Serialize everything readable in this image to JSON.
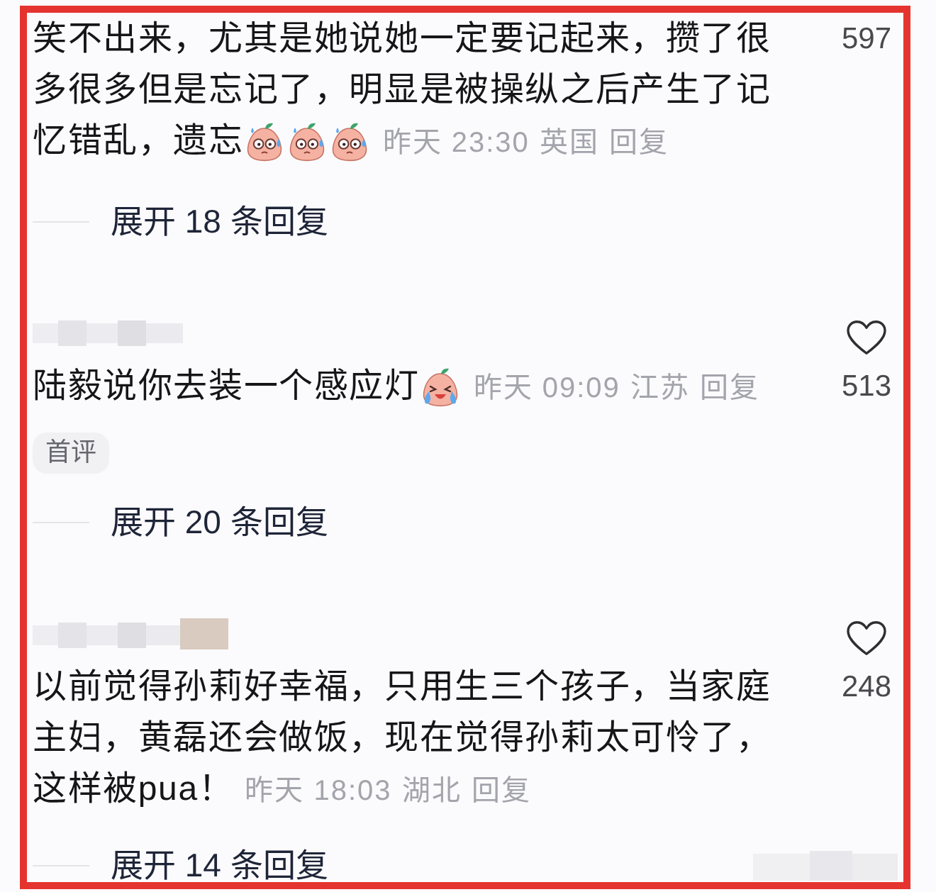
{
  "comments": [
    {
      "author_shown": false,
      "text": "笑不出来，尤其是她说她一定要记起来，攒了很多很多但是忘记了，明显是被操纵之后产生了记忆错乱，遗忘",
      "emojis": [
        {
          "kind": "nervous"
        },
        {
          "kind": "nervous"
        },
        {
          "kind": "nervous"
        }
      ],
      "time": "昨天 23:30",
      "location": "英国",
      "reply": "回复",
      "likes": "597",
      "expand": "展开 18 条回复"
    },
    {
      "author_shown": true,
      "liked": false,
      "text": "陆毅说你去装一个感应灯",
      "emojis": [
        {
          "kind": "laughing"
        }
      ],
      "time": "昨天 09:09",
      "location": "江苏",
      "reply": "回复",
      "likes": "513",
      "badge": "首评",
      "expand": "展开 20 条回复"
    },
    {
      "author_shown": true,
      "liked": false,
      "text": "以前觉得孙莉好幸福，只用生三个孩子，当家庭主妇，黄磊还会做饭，现在觉得孙莉太可怜了，这样被pua！",
      "time": "昨天 18:03",
      "location": "湖北",
      "reply": "回复",
      "likes": "248",
      "expand": "展开 14 条回复"
    }
  ]
}
